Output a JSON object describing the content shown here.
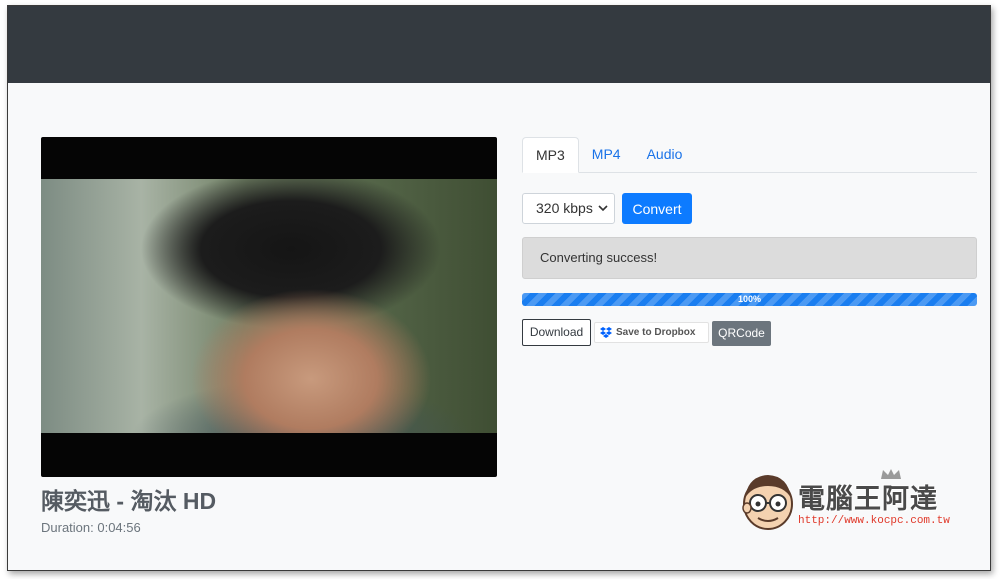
{
  "video": {
    "title": "陳奕迅 - 淘汰 HD",
    "duration": "Duration: 0:04:56"
  },
  "tabs": [
    {
      "label": "MP3",
      "active": true
    },
    {
      "label": "MP4",
      "active": false
    },
    {
      "label": "Audio",
      "active": false
    }
  ],
  "quality_select": {
    "value": "320 kbps"
  },
  "convert_label": "Convert",
  "status_message": "Converting success!",
  "progress": {
    "label": "100%",
    "percent": 100
  },
  "actions": {
    "download_label": "Download",
    "dropbox_label": "Save to Dropbox",
    "qrcode_label": "QRCode"
  },
  "watermark": {
    "title": "電腦王阿達",
    "url": "http://www.kocpc.com.tw"
  },
  "colors": {
    "navbar": "#343a40",
    "primary": "#0d7bff",
    "secondary": "#6c757d",
    "progress": "#1a7ef0"
  }
}
